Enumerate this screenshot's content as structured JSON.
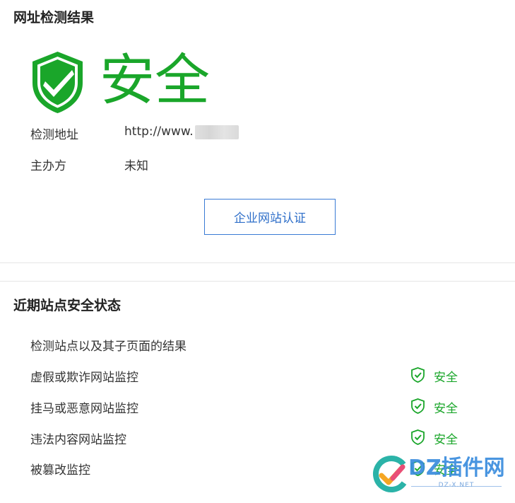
{
  "result": {
    "title": "网址检测结果",
    "verdict": "安全",
    "url_label": "检测地址",
    "url_value": "http://www.          om",
    "sponsor_label": "主办方",
    "sponsor_value": "未知",
    "cert_button_label": "企业网站认证"
  },
  "recent": {
    "title": "近期站点安全状态",
    "description": "检测站点以及其子页面的结果",
    "checks": [
      {
        "label": "虚假或欺诈网站监控",
        "status": "安全"
      },
      {
        "label": "挂马或恶意网站监控",
        "status": "安全"
      },
      {
        "label": "违法内容网站监控",
        "status": "安全"
      },
      {
        "label": "被篡改监控",
        "status": "安全"
      }
    ]
  },
  "colors": {
    "safe": "#1aa62a",
    "button_border": "#3a7bd5",
    "button_text": "#2f6fc9",
    "divider": "#e6e6e6"
  },
  "icons": {
    "verdict": "shield-check-icon",
    "check_status": "shield-check-icon",
    "watermark": "dz-logo-icon"
  }
}
